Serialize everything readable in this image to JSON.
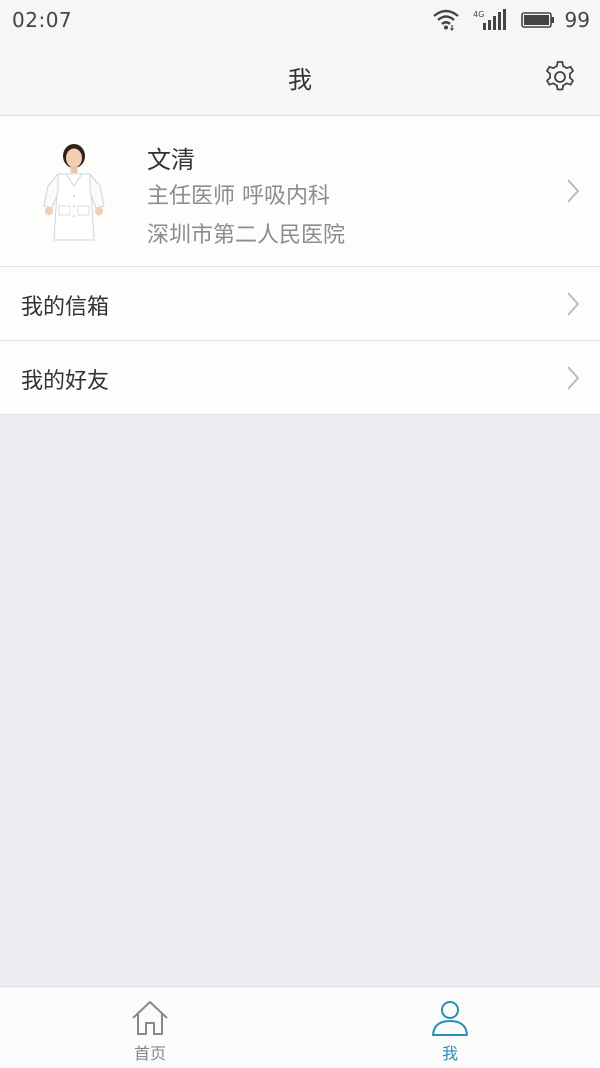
{
  "status_bar": {
    "time": "02:07",
    "network": "4G",
    "battery": "99"
  },
  "header": {
    "title": "我"
  },
  "profile": {
    "name": "文清",
    "title": "主任医师 呼吸内科",
    "hospital": "深圳市第二人民医院"
  },
  "menu": {
    "items": [
      {
        "label": "我的信箱"
      },
      {
        "label": "我的好友"
      }
    ]
  },
  "tabs": [
    {
      "label": "首页",
      "icon": "home-icon",
      "active": false
    },
    {
      "label": "我",
      "icon": "person-icon",
      "active": true
    }
  ],
  "colors": {
    "accent": "#2a8fb5",
    "background": "#eceef3",
    "inactive_tab": "#888888"
  }
}
